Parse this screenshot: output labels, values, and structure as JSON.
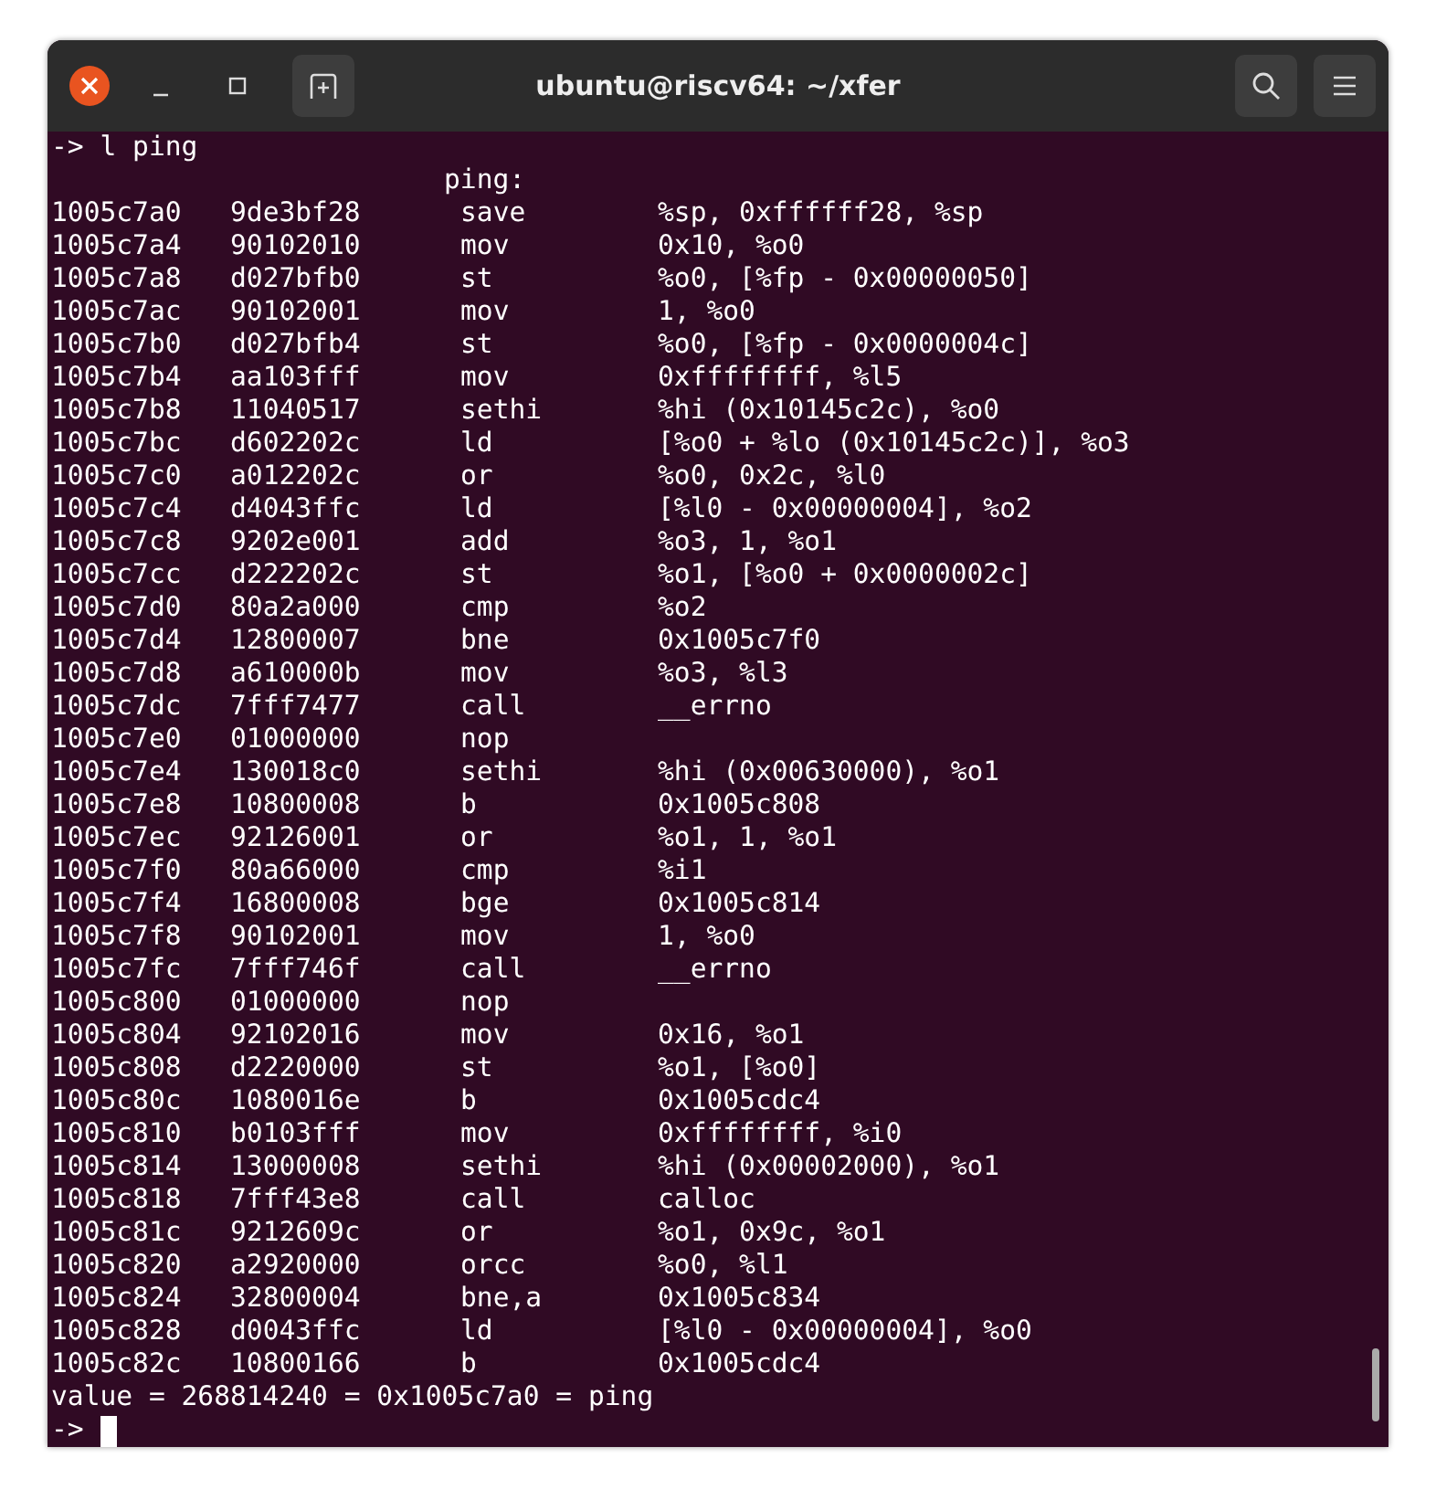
{
  "window": {
    "title": "ubuntu@riscv64: ~/xfer"
  },
  "command": "-> l ping",
  "label": "ping:",
  "rows": [
    {
      "address": "1005c7a0",
      "hex": "9de3bf28",
      "mnemonic": "save",
      "operands": "%sp, 0xffffff28, %sp"
    },
    {
      "address": "1005c7a4",
      "hex": "90102010",
      "mnemonic": "mov",
      "operands": "0x10, %o0"
    },
    {
      "address": "1005c7a8",
      "hex": "d027bfb0",
      "mnemonic": "st",
      "operands": "%o0, [%fp - 0x00000050]"
    },
    {
      "address": "1005c7ac",
      "hex": "90102001",
      "mnemonic": "mov",
      "operands": "1, %o0"
    },
    {
      "address": "1005c7b0",
      "hex": "d027bfb4",
      "mnemonic": "st",
      "operands": "%o0, [%fp - 0x0000004c]"
    },
    {
      "address": "1005c7b4",
      "hex": "aa103fff",
      "mnemonic": "mov",
      "operands": "0xffffffff, %l5"
    },
    {
      "address": "1005c7b8",
      "hex": "11040517",
      "mnemonic": "sethi",
      "operands": "%hi (0x10145c2c), %o0"
    },
    {
      "address": "1005c7bc",
      "hex": "d602202c",
      "mnemonic": "ld",
      "operands": "[%o0 + %lo (0x10145c2c)], %o3"
    },
    {
      "address": "1005c7c0",
      "hex": "a012202c",
      "mnemonic": "or",
      "operands": "%o0, 0x2c, %l0"
    },
    {
      "address": "1005c7c4",
      "hex": "d4043ffc",
      "mnemonic": "ld",
      "operands": "[%l0 - 0x00000004], %o2"
    },
    {
      "address": "1005c7c8",
      "hex": "9202e001",
      "mnemonic": "add",
      "operands": "%o3, 1, %o1"
    },
    {
      "address": "1005c7cc",
      "hex": "d222202c",
      "mnemonic": "st",
      "operands": "%o1, [%o0 + 0x0000002c]"
    },
    {
      "address": "1005c7d0",
      "hex": "80a2a000",
      "mnemonic": "cmp",
      "operands": "%o2"
    },
    {
      "address": "1005c7d4",
      "hex": "12800007",
      "mnemonic": "bne",
      "operands": "0x1005c7f0"
    },
    {
      "address": "1005c7d8",
      "hex": "a610000b",
      "mnemonic": "mov",
      "operands": "%o3, %l3"
    },
    {
      "address": "1005c7dc",
      "hex": "7fff7477",
      "mnemonic": "call",
      "operands": "__errno"
    },
    {
      "address": "1005c7e0",
      "hex": "01000000",
      "mnemonic": "nop"
    },
    {
      "address": "1005c7e4",
      "hex": "130018c0",
      "mnemonic": "sethi",
      "operands": "%hi (0x00630000), %o1"
    },
    {
      "address": "1005c7e8",
      "hex": "10800008",
      "mnemonic": "b",
      "operands": "0x1005c808"
    },
    {
      "address": "1005c7ec",
      "hex": "92126001",
      "mnemonic": "or",
      "operands": "%o1, 1, %o1"
    },
    {
      "address": "1005c7f0",
      "hex": "80a66000",
      "mnemonic": "cmp",
      "operands": "%i1"
    },
    {
      "address": "1005c7f4",
      "hex": "16800008",
      "mnemonic": "bge",
      "operands": "0x1005c814"
    },
    {
      "address": "1005c7f8",
      "hex": "90102001",
      "mnemonic": "mov",
      "operands": "1, %o0"
    },
    {
      "address": "1005c7fc",
      "hex": "7fff746f",
      "mnemonic": "call",
      "operands": "__errno"
    },
    {
      "address": "1005c800",
      "hex": "01000000",
      "mnemonic": "nop"
    },
    {
      "address": "1005c804",
      "hex": "92102016",
      "mnemonic": "mov",
      "operands": "0x16, %o1"
    },
    {
      "address": "1005c808",
      "hex": "d2220000",
      "mnemonic": "st",
      "operands": "%o1, [%o0]"
    },
    {
      "address": "1005c80c",
      "hex": "1080016e",
      "mnemonic": "b",
      "operands": "0x1005cdc4"
    },
    {
      "address": "1005c810",
      "hex": "b0103fff",
      "mnemonic": "mov",
      "operands": "0xffffffff, %i0"
    },
    {
      "address": "1005c814",
      "hex": "13000008",
      "mnemonic": "sethi",
      "operands": "%hi (0x00002000), %o1"
    },
    {
      "address": "1005c818",
      "hex": "7fff43e8",
      "mnemonic": "call",
      "operands": "calloc"
    },
    {
      "address": "1005c81c",
      "hex": "9212609c",
      "mnemonic": "or",
      "operands": "%o1, 0x9c, %o1"
    },
    {
      "address": "1005c820",
      "hex": "a2920000",
      "mnemonic": "orcc",
      "operands": "%o0, %l1"
    },
    {
      "address": "1005c824",
      "hex": "32800004",
      "mnemonic": "bne,a",
      "operands": "0x1005c834"
    },
    {
      "address": "1005c828",
      "hex": "d0043ffc",
      "mnemonic": "ld",
      "operands": "[%l0 - 0x00000004], %o0"
    },
    {
      "address": "1005c82c",
      "hex": "10800166",
      "mnemonic": "b",
      "operands": "0x1005cdc4"
    }
  ],
  "result": "value = 268814240 = 0x1005c7a0 = ping",
  "prompt": "->"
}
